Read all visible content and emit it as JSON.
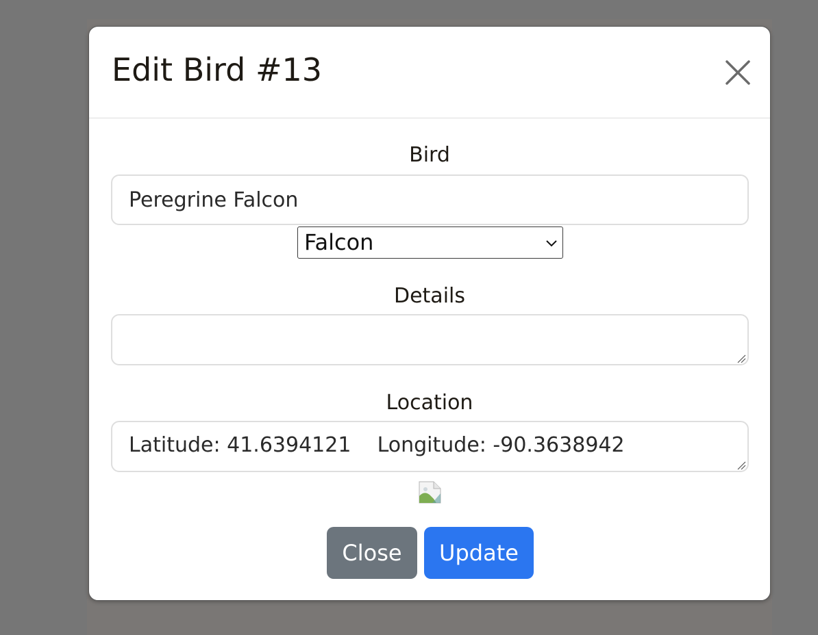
{
  "modal": {
    "title": "Edit Bird #13",
    "close_icon": "close-icon"
  },
  "form": {
    "bird": {
      "label": "Bird",
      "value": "Peregrine Falcon"
    },
    "category": {
      "selected": "Falcon"
    },
    "details": {
      "label": "Details",
      "value": ""
    },
    "location": {
      "label": "Location",
      "value": "Latitude: 41.6394121    Longitude: -90.3638942"
    },
    "image_icon": "broken-image-icon"
  },
  "actions": {
    "close_label": "Close",
    "update_label": "Update"
  },
  "colors": {
    "backdrop": "#767676",
    "secondary_button": "#6c757d",
    "primary_button": "#2b76f0",
    "text": "#1e1a14"
  }
}
